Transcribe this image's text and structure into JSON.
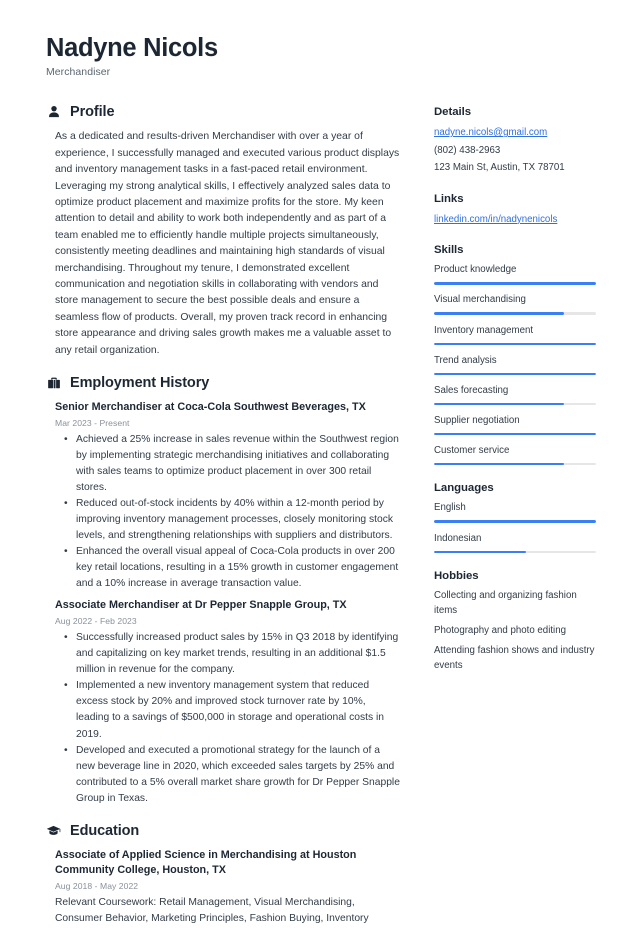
{
  "header": {
    "full_name": "Nadyne Nicols",
    "job_title": "Merchandiser"
  },
  "accent_color": "#3b7ff5",
  "link_color": "#2f6fe0",
  "main": {
    "profile": {
      "icon": "person-icon",
      "title": "Profile",
      "text": "As a dedicated and results-driven Merchandiser with over a year of experience, I successfully managed and executed various product displays and inventory management tasks in a fast-paced retail environment. Leveraging my strong analytical skills, I effectively analyzed sales data to optimize product placement and maximize profits for the store. My keen attention to detail and ability to work both independently and as part of a team enabled me to efficiently handle multiple projects simultaneously, consistently meeting deadlines and maintaining high standards of visual merchandising. Throughout my tenure, I demonstrated excellent communication and negotiation skills in collaborating with vendors and store management to secure the best possible deals and ensure a seamless flow of products. Overall, my proven track record in enhancing store appearance and driving sales growth makes me a valuable asset to any retail organization."
    },
    "employment": {
      "icon": "briefcase-icon",
      "title": "Employment History",
      "entries": [
        {
          "title": "Senior Merchandiser at Coca-Cola Southwest Beverages, TX",
          "date": "Mar 2023 - Present",
          "bullets": [
            "Achieved a 25% increase in sales revenue within the Southwest region by implementing strategic merchandising initiatives and collaborating with sales teams to optimize product placement in over 300 retail stores.",
            "Reduced out-of-stock incidents by 40% within a 12-month period by improving inventory management processes, closely monitoring stock levels, and strengthening relationships with suppliers and distributors.",
            "Enhanced the overall visual appeal of Coca-Cola products in over 200 key retail locations, resulting in a 15% growth in customer engagement and a 10% increase in average transaction value."
          ]
        },
        {
          "title": "Associate Merchandiser at Dr Pepper Snapple Group, TX",
          "date": "Aug 2022 - Feb 2023",
          "bullets": [
            "Successfully increased product sales by 15% in Q3 2018 by identifying and capitalizing on key market trends, resulting in an additional $1.5 million in revenue for the company.",
            "Implemented a new inventory management system that reduced excess stock by 20% and improved stock turnover rate by 10%, leading to a savings of $500,000 in storage and operational costs in 2019.",
            "Developed and executed a promotional strategy for the launch of a new beverage line in 2020, which exceeded sales targets by 25% and contributed to a 5% overall market share growth for Dr Pepper Snapple Group in Texas."
          ]
        }
      ]
    },
    "education": {
      "icon": "graduation-cap-icon",
      "title": "Education",
      "entries": [
        {
          "title": "Associate of Applied Science in Merchandising at Houston Community College, Houston, TX",
          "date": "Aug 2018 - May 2022",
          "description": "Relevant Coursework: Retail Management, Visual Merchandising, Consumer Behavior, Marketing Principles, Fashion Buying, Inventory"
        }
      ]
    }
  },
  "sidebar": {
    "details": {
      "title": "Details",
      "email": "nadyne.nicols@gmail.com",
      "phone": "(802) 438-2963",
      "address": "123 Main St, Austin, TX 78701"
    },
    "links": {
      "title": "Links",
      "items": [
        {
          "label": "linkedin.com/in/nadynenicols"
        }
      ]
    },
    "skills": {
      "title": "Skills",
      "items": [
        {
          "label": "Product knowledge",
          "level": 100
        },
        {
          "label": "Visual merchandising",
          "level": 80
        },
        {
          "label": "Inventory management",
          "level": 100
        },
        {
          "label": "Trend analysis",
          "level": 100
        },
        {
          "label": "Sales forecasting",
          "level": 80
        },
        {
          "label": "Supplier negotiation",
          "level": 100
        },
        {
          "label": "Customer service",
          "level": 80
        }
      ]
    },
    "languages": {
      "title": "Languages",
      "items": [
        {
          "label": "English",
          "level": 100
        },
        {
          "label": "Indonesian",
          "level": 57
        }
      ]
    },
    "hobbies": {
      "title": "Hobbies",
      "items": [
        {
          "label": "Collecting and organizing fashion items"
        },
        {
          "label": "Photography and photo editing"
        },
        {
          "label": "Attending fashion shows and industry events"
        }
      ]
    }
  }
}
